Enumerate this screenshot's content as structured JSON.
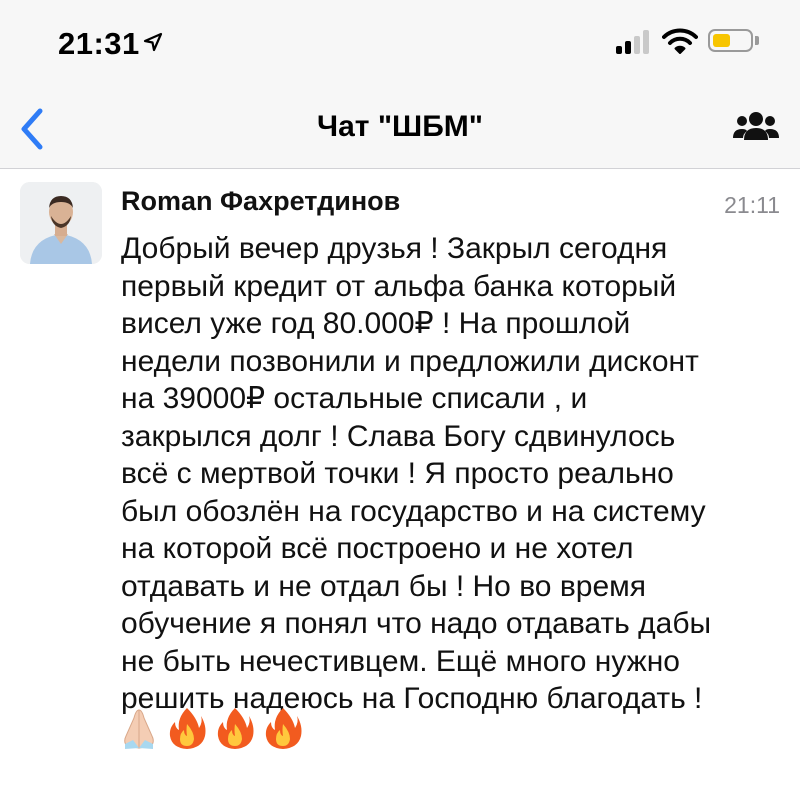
{
  "status_bar": {
    "time": "21:31",
    "icons": [
      "location-arrow-icon",
      "cellular-signal-icon",
      "wifi-icon",
      "battery-icon"
    ],
    "battery_color": "#f7c500"
  },
  "nav": {
    "title": "Чат \"ШБМ\"",
    "back_icon": "chevron-left-icon",
    "members_icon": "group-icon",
    "accent_color": "#2f7cf6"
  },
  "message": {
    "sender": "Roman Фахретдинов",
    "time": "21:11",
    "lines": [
      "Добрый вечер друзья ! Закрыл сегодня",
      "первый кредит от альфа банка который",
      "висел уже год 80.000₽ ! На прошлой",
      "недели позвонили и предложили дисконт",
      "на 39000₽ остальные списали , и",
      "закрылся долг ! Слава Богу сдвинулось",
      "всё с мертвой точки ! Я просто реально",
      "был обозлён на государство и на систему",
      "на которой всё построено и не хотел",
      "отдавать и не отдал бы ! Но во время",
      "обучение я понял что надо отдавать дабы",
      "не быть нечестивцем. Ещё много нужно",
      "решить надеюсь на Господню благодать !"
    ],
    "emojis": [
      "praying-hands-emoji",
      "fire-emoji",
      "fire-emoji",
      "fire-emoji"
    ]
  }
}
